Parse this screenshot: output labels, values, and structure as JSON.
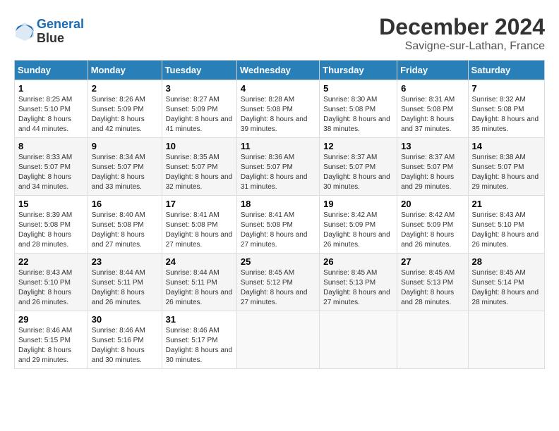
{
  "header": {
    "logo_line1": "General",
    "logo_line2": "Blue",
    "month": "December 2024",
    "location": "Savigne-sur-Lathan, France"
  },
  "weekdays": [
    "Sunday",
    "Monday",
    "Tuesday",
    "Wednesday",
    "Thursday",
    "Friday",
    "Saturday"
  ],
  "weeks": [
    [
      {
        "day": 1,
        "sunrise": "8:25 AM",
        "sunset": "5:10 PM",
        "daylight": "8 hours and 44 minutes."
      },
      {
        "day": 2,
        "sunrise": "8:26 AM",
        "sunset": "5:09 PM",
        "daylight": "8 hours and 42 minutes."
      },
      {
        "day": 3,
        "sunrise": "8:27 AM",
        "sunset": "5:09 PM",
        "daylight": "8 hours and 41 minutes."
      },
      {
        "day": 4,
        "sunrise": "8:28 AM",
        "sunset": "5:08 PM",
        "daylight": "8 hours and 39 minutes."
      },
      {
        "day": 5,
        "sunrise": "8:30 AM",
        "sunset": "5:08 PM",
        "daylight": "8 hours and 38 minutes."
      },
      {
        "day": 6,
        "sunrise": "8:31 AM",
        "sunset": "5:08 PM",
        "daylight": "8 hours and 37 minutes."
      },
      {
        "day": 7,
        "sunrise": "8:32 AM",
        "sunset": "5:08 PM",
        "daylight": "8 hours and 35 minutes."
      }
    ],
    [
      {
        "day": 8,
        "sunrise": "8:33 AM",
        "sunset": "5:07 PM",
        "daylight": "8 hours and 34 minutes."
      },
      {
        "day": 9,
        "sunrise": "8:34 AM",
        "sunset": "5:07 PM",
        "daylight": "8 hours and 33 minutes."
      },
      {
        "day": 10,
        "sunrise": "8:35 AM",
        "sunset": "5:07 PM",
        "daylight": "8 hours and 32 minutes."
      },
      {
        "day": 11,
        "sunrise": "8:36 AM",
        "sunset": "5:07 PM",
        "daylight": "8 hours and 31 minutes."
      },
      {
        "day": 12,
        "sunrise": "8:37 AM",
        "sunset": "5:07 PM",
        "daylight": "8 hours and 30 minutes."
      },
      {
        "day": 13,
        "sunrise": "8:37 AM",
        "sunset": "5:07 PM",
        "daylight": "8 hours and 29 minutes."
      },
      {
        "day": 14,
        "sunrise": "8:38 AM",
        "sunset": "5:07 PM",
        "daylight": "8 hours and 29 minutes."
      }
    ],
    [
      {
        "day": 15,
        "sunrise": "8:39 AM",
        "sunset": "5:08 PM",
        "daylight": "8 hours and 28 minutes."
      },
      {
        "day": 16,
        "sunrise": "8:40 AM",
        "sunset": "5:08 PM",
        "daylight": "8 hours and 27 minutes."
      },
      {
        "day": 17,
        "sunrise": "8:41 AM",
        "sunset": "5:08 PM",
        "daylight": "8 hours and 27 minutes."
      },
      {
        "day": 18,
        "sunrise": "8:41 AM",
        "sunset": "5:08 PM",
        "daylight": "8 hours and 27 minutes."
      },
      {
        "day": 19,
        "sunrise": "8:42 AM",
        "sunset": "5:09 PM",
        "daylight": "8 hours and 26 minutes."
      },
      {
        "day": 20,
        "sunrise": "8:42 AM",
        "sunset": "5:09 PM",
        "daylight": "8 hours and 26 minutes."
      },
      {
        "day": 21,
        "sunrise": "8:43 AM",
        "sunset": "5:10 PM",
        "daylight": "8 hours and 26 minutes."
      }
    ],
    [
      {
        "day": 22,
        "sunrise": "8:43 AM",
        "sunset": "5:10 PM",
        "daylight": "8 hours and 26 minutes."
      },
      {
        "day": 23,
        "sunrise": "8:44 AM",
        "sunset": "5:11 PM",
        "daylight": "8 hours and 26 minutes."
      },
      {
        "day": 24,
        "sunrise": "8:44 AM",
        "sunset": "5:11 PM",
        "daylight": "8 hours and 26 minutes."
      },
      {
        "day": 25,
        "sunrise": "8:45 AM",
        "sunset": "5:12 PM",
        "daylight": "8 hours and 27 minutes."
      },
      {
        "day": 26,
        "sunrise": "8:45 AM",
        "sunset": "5:13 PM",
        "daylight": "8 hours and 27 minutes."
      },
      {
        "day": 27,
        "sunrise": "8:45 AM",
        "sunset": "5:13 PM",
        "daylight": "8 hours and 28 minutes."
      },
      {
        "day": 28,
        "sunrise": "8:45 AM",
        "sunset": "5:14 PM",
        "daylight": "8 hours and 28 minutes."
      }
    ],
    [
      {
        "day": 29,
        "sunrise": "8:46 AM",
        "sunset": "5:15 PM",
        "daylight": "8 hours and 29 minutes."
      },
      {
        "day": 30,
        "sunrise": "8:46 AM",
        "sunset": "5:16 PM",
        "daylight": "8 hours and 30 minutes."
      },
      {
        "day": 31,
        "sunrise": "8:46 AM",
        "sunset": "5:17 PM",
        "daylight": "8 hours and 30 minutes."
      },
      null,
      null,
      null,
      null
    ]
  ]
}
